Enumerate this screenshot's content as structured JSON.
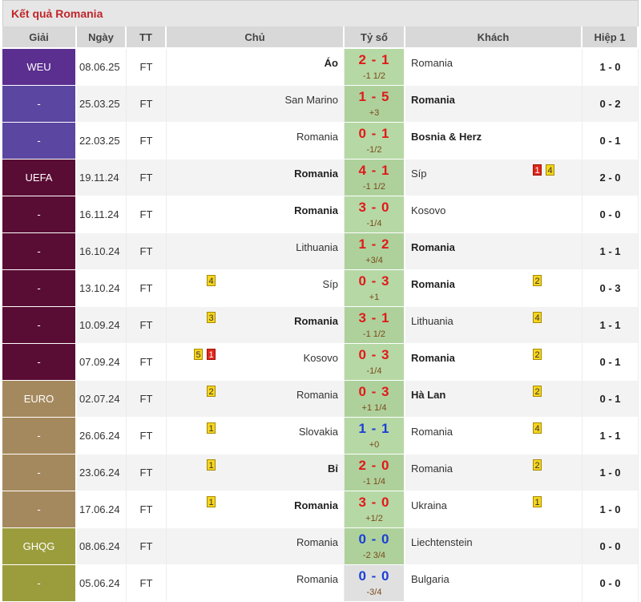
{
  "title": "Kết quả Romania",
  "headers": [
    "Giải",
    "Ngày",
    "TT",
    "Chủ",
    "Tỷ số",
    "Khách",
    "Hiệp 1"
  ],
  "rows": [
    {
      "league": "WEU",
      "league_color": "#5b2f8f",
      "date": "08.06.25",
      "status": "FT",
      "home": "Áo",
      "home_bold": true,
      "home_cards": [],
      "score": "2 - 1",
      "score_color": "red",
      "score_bg": "green",
      "handicap": "-1 1/2",
      "away": "Romania",
      "away_bold": false,
      "away_cards": [],
      "half": "1 - 0"
    },
    {
      "league": "-",
      "league_color": "#5b47a2",
      "date": "25.03.25",
      "status": "FT",
      "home": "San Marino",
      "home_bold": false,
      "home_cards": [],
      "score": "1 - 5",
      "score_color": "red",
      "score_bg": "green",
      "handicap": "+3",
      "away": "Romania",
      "away_bold": true,
      "away_cards": [],
      "half": "0 - 2"
    },
    {
      "league": "-",
      "league_color": "#5b47a2",
      "date": "22.03.25",
      "status": "FT",
      "home": "Romania",
      "home_bold": false,
      "home_cards": [],
      "score": "0 - 1",
      "score_color": "red",
      "score_bg": "green",
      "handicap": "-1/2",
      "away": "Bosnia & Herz",
      "away_bold": true,
      "away_cards": [],
      "half": "0 - 1"
    },
    {
      "league": "UEFA",
      "league_color": "#5a0d34",
      "date": "19.11.24",
      "status": "FT",
      "home": "Romania",
      "home_bold": true,
      "home_cards": [],
      "score": "4 - 1",
      "score_color": "red",
      "score_bg": "green",
      "handicap": "-1 1/2",
      "away": "Síp",
      "away_bold": false,
      "away_cards": [
        {
          "type": "red",
          "n": "1"
        },
        {
          "type": "yellow",
          "n": "4"
        }
      ],
      "half": "2 - 0"
    },
    {
      "league": "-",
      "league_color": "#5a0d34",
      "date": "16.11.24",
      "status": "FT",
      "home": "Romania",
      "home_bold": true,
      "home_cards": [],
      "score": "3 - 0",
      "score_color": "red",
      "score_bg": "green",
      "handicap": "-1/4",
      "away": "Kosovo",
      "away_bold": false,
      "away_cards": [],
      "half": "0 - 0"
    },
    {
      "league": "-",
      "league_color": "#5a0d34",
      "date": "16.10.24",
      "status": "FT",
      "home": "Lithuania",
      "home_bold": false,
      "home_cards": [],
      "score": "1 - 2",
      "score_color": "red",
      "score_bg": "green",
      "handicap": "+3/4",
      "away": "Romania",
      "away_bold": true,
      "away_cards": [],
      "half": "1 - 1"
    },
    {
      "league": "-",
      "league_color": "#5a0d34",
      "date": "13.10.24",
      "status": "FT",
      "home": "Síp",
      "home_bold": false,
      "home_cards": [
        {
          "type": "yellow",
          "n": "4"
        }
      ],
      "score": "0 - 3",
      "score_color": "red",
      "score_bg": "green",
      "handicap": "+1",
      "away": "Romania",
      "away_bold": true,
      "away_cards": [
        {
          "type": "yellow",
          "n": "2"
        }
      ],
      "half": "0 - 3"
    },
    {
      "league": "-",
      "league_color": "#5a0d34",
      "date": "10.09.24",
      "status": "FT",
      "home": "Romania",
      "home_bold": true,
      "home_cards": [
        {
          "type": "yellow",
          "n": "3"
        }
      ],
      "score": "3 - 1",
      "score_color": "red",
      "score_bg": "green",
      "handicap": "-1 1/2",
      "away": "Lithuania",
      "away_bold": false,
      "away_cards": [
        {
          "type": "yellow",
          "n": "4"
        }
      ],
      "half": "1 - 1"
    },
    {
      "league": "-",
      "league_color": "#5a0d34",
      "date": "07.09.24",
      "status": "FT",
      "home": "Kosovo",
      "home_bold": false,
      "home_cards": [
        {
          "type": "yellow",
          "n": "5"
        },
        {
          "type": "red",
          "n": "1"
        }
      ],
      "score": "0 - 3",
      "score_color": "red",
      "score_bg": "green",
      "handicap": "-1/4",
      "away": "Romania",
      "away_bold": true,
      "away_cards": [
        {
          "type": "yellow",
          "n": "2"
        }
      ],
      "half": "0 - 1"
    },
    {
      "league": "EURO",
      "league_color": "#a5895e",
      "date": "02.07.24",
      "status": "FT",
      "home": "Romania",
      "home_bold": false,
      "home_cards": [
        {
          "type": "yellow",
          "n": "2"
        }
      ],
      "score": "0 - 3",
      "score_color": "red",
      "score_bg": "green",
      "handicap": "+1 1/4",
      "away": "Hà Lan",
      "away_bold": true,
      "away_cards": [
        {
          "type": "yellow",
          "n": "2"
        }
      ],
      "half": "0 - 1"
    },
    {
      "league": "-",
      "league_color": "#a5895e",
      "date": "26.06.24",
      "status": "FT",
      "home": "Slovakia",
      "home_bold": false,
      "home_cards": [
        {
          "type": "yellow",
          "n": "1"
        }
      ],
      "score": "1 - 1",
      "score_color": "blue",
      "score_bg": "green",
      "handicap": "+0",
      "away": "Romania",
      "away_bold": false,
      "away_cards": [
        {
          "type": "yellow",
          "n": "4"
        }
      ],
      "half": "1 - 1"
    },
    {
      "league": "-",
      "league_color": "#a5895e",
      "date": "23.06.24",
      "status": "FT",
      "home": "Bỉ",
      "home_bold": true,
      "home_cards": [
        {
          "type": "yellow",
          "n": "1"
        }
      ],
      "score": "2 - 0",
      "score_color": "red",
      "score_bg": "green",
      "handicap": "-1 1/4",
      "away": "Romania",
      "away_bold": false,
      "away_cards": [
        {
          "type": "yellow",
          "n": "2"
        }
      ],
      "half": "1 - 0"
    },
    {
      "league": "-",
      "league_color": "#a5895e",
      "date": "17.06.24",
      "status": "FT",
      "home": "Romania",
      "home_bold": true,
      "home_cards": [
        {
          "type": "yellow",
          "n": "1"
        }
      ],
      "score": "3 - 0",
      "score_color": "red",
      "score_bg": "green",
      "handicap": "+1/2",
      "away": "Ukraina",
      "away_bold": false,
      "away_cards": [
        {
          "type": "yellow",
          "n": "1"
        }
      ],
      "half": "1 - 0"
    },
    {
      "league": "GHQG",
      "league_color": "#9b9d3d",
      "date": "08.06.24",
      "status": "FT",
      "home": "Romania",
      "home_bold": false,
      "home_cards": [],
      "score": "0 - 0",
      "score_color": "blue",
      "score_bg": "neutral",
      "handicap": "-2 3/4",
      "away": "Liechtenstein",
      "away_bold": false,
      "away_cards": [],
      "half": "0 - 0"
    },
    {
      "league": "-",
      "league_color": "#9b9d3d",
      "date": "05.06.24",
      "status": "FT",
      "home": "Romania",
      "home_bold": false,
      "home_cards": [],
      "score": "0 - 0",
      "score_color": "blue",
      "score_bg": "neutral",
      "handicap": "-3/4",
      "away": "Bulgaria",
      "away_bold": false,
      "away_cards": [],
      "half": "0 - 0"
    }
  ]
}
